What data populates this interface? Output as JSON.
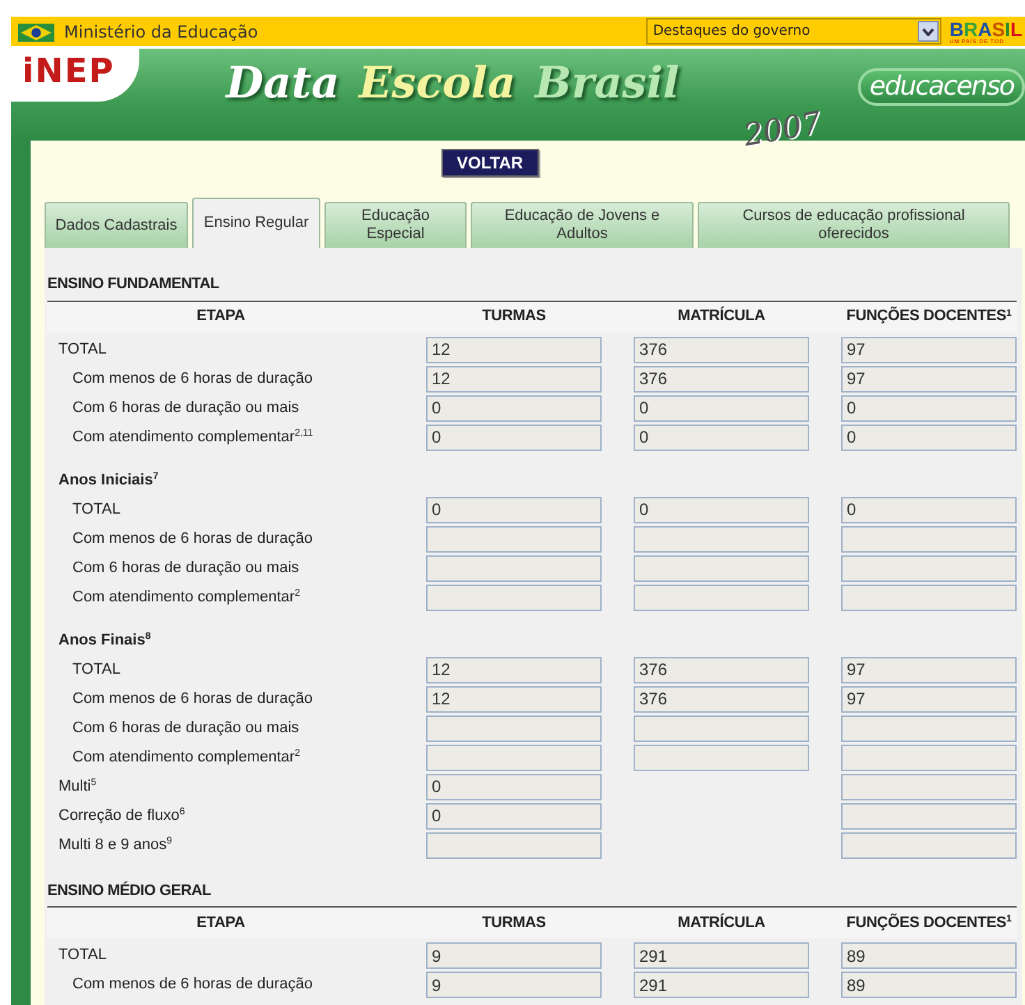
{
  "top_bar": {
    "ministry": "Ministério da Educação",
    "dropdown": {
      "value": "Destaques do governo"
    },
    "brand": {
      "name": "BRASIL",
      "tagline": "UM PAÍS DE TOD"
    }
  },
  "header": {
    "logo": "iNEP",
    "title": [
      "Data",
      "Escola",
      "Brasil"
    ],
    "year": "2007",
    "census_logo": "educacenso"
  },
  "back_button": "VOLTAR",
  "tabs": [
    {
      "label": "Dados Cadastrais",
      "selected": false
    },
    {
      "label": "Ensino Regular",
      "selected": true
    },
    {
      "label": "Educação Especial",
      "selected": false
    },
    {
      "label": "Educação de Jovens e Adultos",
      "selected": false
    },
    {
      "label": "Cursos de educação profissional oferecidos",
      "selected": false
    }
  ],
  "sections": [
    {
      "title": "ENSINO FUNDAMENTAL",
      "label_header": "ETAPA",
      "columns": [
        "TURMAS",
        "MATRÍCULA",
        "FUNÇÕES DOCENTES$^{1}$"
      ],
      "rows": [
        {
          "kind": "row",
          "label": "TOTAL",
          "cells": [
            {
              "kind": "field",
              "value": "12"
            },
            {
              "kind": "field",
              "value": "376"
            },
            {
              "kind": "field",
              "value": "97"
            }
          ],
          "children": [
            {
              "kind": "row",
              "label": "Com menos de 6 horas de duração",
              "cells": [
                {
                  "kind": "field",
                  "value": "12"
                },
                {
                  "kind": "field",
                  "value": "376"
                },
                {
                  "kind": "field",
                  "value": "97"
                }
              ]
            },
            {
              "kind": "row",
              "label": "Com 6 horas de duração ou mais",
              "cells": [
                {
                  "kind": "field",
                  "value": "0"
                },
                {
                  "kind": "field",
                  "value": "0"
                },
                {
                  "kind": "field",
                  "value": "0"
                }
              ]
            },
            {
              "kind": "row",
              "label": "Com atendimento complementar$^{2,11}$",
              "cells": [
                {
                  "kind": "field",
                  "value": "0"
                },
                {
                  "kind": "field",
                  "value": "0"
                },
                {
                  "kind": "field",
                  "value": "0"
                }
              ]
            }
          ]
        },
        {
          "kind": "group",
          "label": "Anos Iniciais$^{7}$",
          "children": [
            {
              "kind": "row",
              "label": "TOTAL",
              "cells": [
                {
                  "kind": "field",
                  "value": "0"
                },
                {
                  "kind": "field",
                  "value": "0"
                },
                {
                  "kind": "field",
                  "value": "0"
                }
              ]
            },
            {
              "kind": "row",
              "label": "Com menos de 6 horas de duração",
              "cells": [
                {
                  "kind": "field"
                },
                {
                  "kind": "field"
                },
                {
                  "kind": "field"
                }
              ]
            },
            {
              "kind": "row",
              "label": "Com 6 horas de duração ou mais",
              "cells": [
                {
                  "kind": "field"
                },
                {
                  "kind": "field"
                },
                {
                  "kind": "field"
                }
              ]
            },
            {
              "kind": "row",
              "label": "Com atendimento complementar$^{2}$",
              "cells": [
                {
                  "kind": "field"
                },
                {
                  "kind": "field"
                },
                {
                  "kind": "field"
                }
              ]
            }
          ]
        },
        {
          "kind": "group",
          "label": "Anos Finais$^{8}$",
          "children": [
            {
              "kind": "row",
              "label": "TOTAL",
              "cells": [
                {
                  "kind": "field",
                  "value": "12"
                },
                {
                  "kind": "field",
                  "value": "376"
                },
                {
                  "kind": "field",
                  "value": "97"
                }
              ]
            },
            {
              "kind": "row",
              "label": "Com menos de 6 horas de duração",
              "cells": [
                {
                  "kind": "field",
                  "value": "12"
                },
                {
                  "kind": "field",
                  "value": "376"
                },
                {
                  "kind": "field",
                  "value": "97"
                }
              ]
            },
            {
              "kind": "row",
              "label": "Com 6 horas de duração ou mais",
              "cells": [
                {
                  "kind": "field"
                },
                {
                  "kind": "field"
                },
                {
                  "kind": "field"
                }
              ]
            },
            {
              "kind": "row",
              "label": "Com atendimento complementar$^{2}$",
              "cells": [
                {
                  "kind": "field"
                },
                {
                  "kind": "field"
                },
                {
                  "kind": "field"
                }
              ]
            }
          ]
        },
        {
          "kind": "row",
          "label": "Multi$^{5}$",
          "cells": [
            {
              "kind": "field",
              "value": "0"
            },
            {
              "kind": "none"
            },
            {
              "kind": "field"
            }
          ]
        },
        {
          "kind": "row",
          "label": "Correção de fluxo$^{6}$",
          "cells": [
            {
              "kind": "field",
              "value": "0"
            },
            {
              "kind": "none"
            },
            {
              "kind": "field"
            }
          ]
        },
        {
          "kind": "row",
          "label": "Multi 8 e 9 anos$^{9}$",
          "cells": [
            {
              "kind": "field"
            },
            {
              "kind": "none"
            },
            {
              "kind": "field"
            }
          ]
        }
      ]
    },
    {
      "title": "ENSINO MÉDIO GERAL",
      "label_header": "ETAPA",
      "columns": [
        "TURMAS",
        "MATRÍCULA",
        "FUNÇÕES DOCENTES$^{1}$"
      ],
      "rows": [
        {
          "kind": "row",
          "label": "TOTAL",
          "cells": [
            {
              "kind": "field",
              "value": "9"
            },
            {
              "kind": "field",
              "value": "291"
            },
            {
              "kind": "field",
              "value": "89"
            }
          ],
          "children": [
            {
              "kind": "row",
              "label": "Com menos de 6 horas de duração",
              "cells": [
                {
                  "kind": "field",
                  "value": "9"
                },
                {
                  "kind": "field",
                  "value": "291"
                },
                {
                  "kind": "field",
                  "value": "89"
                }
              ]
            }
          ]
        }
      ]
    }
  ]
}
